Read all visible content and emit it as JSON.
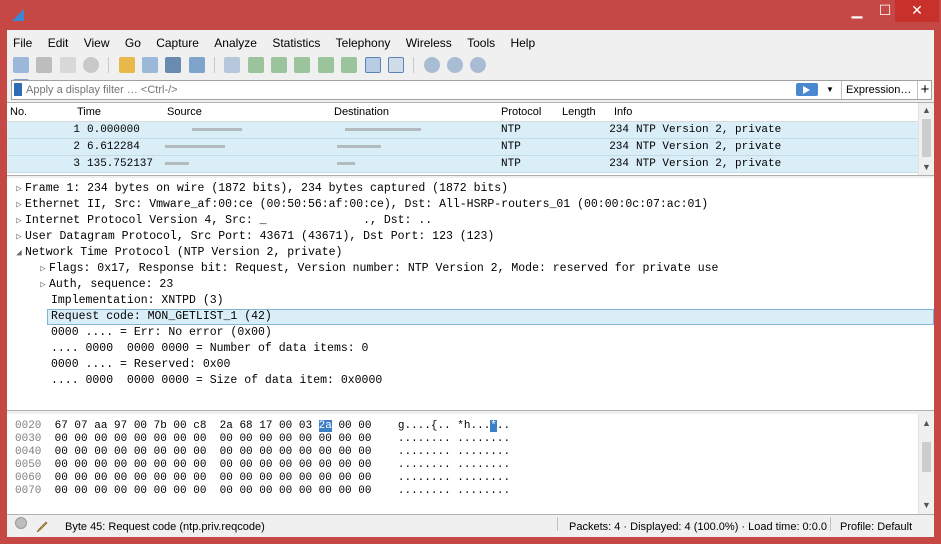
{
  "colors": {
    "titlebar": "#c64844",
    "row_bg": "#daeef8",
    "selection": "#3c7fc6"
  },
  "menu": [
    {
      "label": "File"
    },
    {
      "label": "Edit"
    },
    {
      "label": "View"
    },
    {
      "label": "Go"
    },
    {
      "label": "Capture"
    },
    {
      "label": "Analyze"
    },
    {
      "label": "Statistics"
    },
    {
      "label": "Telephony"
    },
    {
      "label": "Wireless"
    },
    {
      "label": "Tools"
    },
    {
      "label": "Help"
    }
  ],
  "filter": {
    "placeholder": "Apply a display filter … <Ctrl-/>",
    "expression_label": "Expression…",
    "plus_label": "+"
  },
  "packet_list": {
    "headers": {
      "no": "No.",
      "time": "Time",
      "source": "Source",
      "destination": "Destination",
      "protocol": "Protocol",
      "length": "Length",
      "info": "Info"
    },
    "rows": [
      {
        "no": "1",
        "time": "0.000000",
        "protocol": "NTP",
        "length": "234",
        "info": "NTP Version 2, private"
      },
      {
        "no": "2",
        "time": "6.612284",
        "protocol": "NTP",
        "length": "234",
        "info": "NTP Version 2, private"
      },
      {
        "no": "3",
        "time": "135.752137",
        "protocol": "NTP",
        "length": "234",
        "info": "NTP Version 2, private"
      }
    ]
  },
  "details": [
    {
      "tri": "▷",
      "text": "Frame 1: 234 bytes on wire (1872 bits), 234 bytes captured (1872 bits)"
    },
    {
      "tri": "▷",
      "text": "Ethernet II, Src: Vmware_af:00:ce (00:50:56:af:00:ce), Dst: All-HSRP-routers_01 (00:00:0c:07:ac:01)"
    },
    {
      "tri": "▷",
      "text": "Internet Protocol Version 4, Src: _              ., Dst: .."
    },
    {
      "tri": "▷",
      "text": "User Datagram Protocol, Src Port: 43671 (43671), Dst Port: 123 (123)"
    },
    {
      "tri": "◢",
      "text": "Network Time Protocol (NTP Version 2, private)"
    },
    {
      "tri": "▷",
      "text": "Flags: 0x17, Response bit: Request, Version number: NTP Version 2, Mode: reserved for private use"
    },
    {
      "tri": "▷",
      "text": "Auth, sequence: 23"
    },
    {
      "tri": "",
      "text": "Implementation: XNTPD (3)"
    },
    {
      "tri": "",
      "text": "Request code: MON_GETLIST_1 (42)"
    },
    {
      "tri": "",
      "text": "0000 .... = Err: No error (0x00)"
    },
    {
      "tri": "",
      "text": ".... 0000  0000 0000 = Number of data items: 0"
    },
    {
      "tri": "",
      "text": "0000 .... = Reserved: 0x00"
    },
    {
      "tri": "",
      "text": ".... 0000  0000 0000 = Size of data item: 0x0000"
    }
  ],
  "hex": [
    {
      "offset": "0020",
      "bytes_a": "67 07 aa 97 00 7b 00 c8  2a 68 17 00 03 ",
      "hl": "2a",
      "bytes_b": " 00 00",
      "ascii_a": "g....{.. *h...",
      "ascii_hl": "*",
      "ascii_b": ".."
    },
    {
      "offset": "0030",
      "bytes_a": "00 00 00 00 00 00 00 00  00 00 00 00 00 00 00 00",
      "hl": "",
      "bytes_b": "",
      "ascii_a": "........ ........",
      "ascii_hl": "",
      "ascii_b": ""
    },
    {
      "offset": "0040",
      "bytes_a": "00 00 00 00 00 00 00 00  00 00 00 00 00 00 00 00",
      "hl": "",
      "bytes_b": "",
      "ascii_a": "........ ........",
      "ascii_hl": "",
      "ascii_b": ""
    },
    {
      "offset": "0050",
      "bytes_a": "00 00 00 00 00 00 00 00  00 00 00 00 00 00 00 00",
      "hl": "",
      "bytes_b": "",
      "ascii_a": "........ ........",
      "ascii_hl": "",
      "ascii_b": ""
    },
    {
      "offset": "0060",
      "bytes_a": "00 00 00 00 00 00 00 00  00 00 00 00 00 00 00 00",
      "hl": "",
      "bytes_b": "",
      "ascii_a": "........ ........",
      "ascii_hl": "",
      "ascii_b": ""
    },
    {
      "offset": "0070",
      "bytes_a": "00 00 00 00 00 00 00 00  00 00 00 00 00 00 00 00",
      "hl": "",
      "bytes_b": "",
      "ascii_a": "........ ........",
      "ascii_hl": "",
      "ascii_b": ""
    }
  ],
  "status": {
    "field_text": "Byte 45: Request code (ntp.priv.reqcode)",
    "packets": "Packets: 4 · Displayed: 4 (100.0%) · Load time: 0:0.0",
    "profile": "Profile: Default"
  }
}
